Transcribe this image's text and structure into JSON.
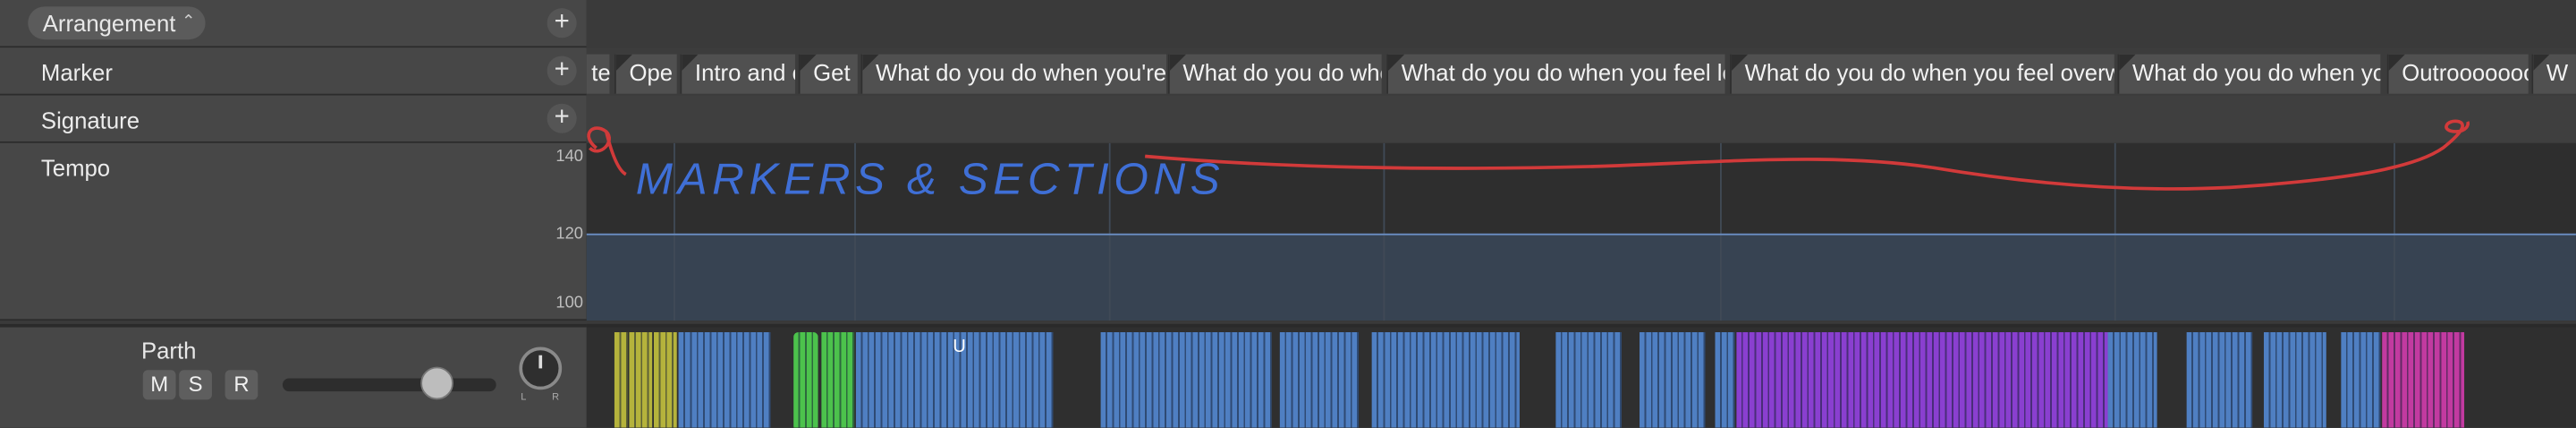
{
  "global_tracks": {
    "arrangement": {
      "label": "Arrangement",
      "chevron": "⌃⌄",
      "add": "+"
    },
    "marker": {
      "label": "Marker",
      "add": "+"
    },
    "signature": {
      "label": "Signature",
      "add": "+"
    },
    "tempo": {
      "label": "Tempo",
      "ticks": [
        "140",
        "120",
        "100"
      ],
      "tempo_value_bpm": 120
    }
  },
  "markers": [
    {
      "label": "ter"
    },
    {
      "label": "Ope"
    },
    {
      "label": "Intro and catching"
    },
    {
      "label": "Get into"
    },
    {
      "label": "What do you do when you're procrastinating?"
    },
    {
      "label": "What do you do when you want to"
    },
    {
      "label": "What do you do when you feel lonely?"
    },
    {
      "label": "What do you do when you feel overwhelmed?"
    },
    {
      "label": "What do you do when you don't feel inspired to do"
    },
    {
      "label": "Outroooooooo"
    },
    {
      "label": "W"
    }
  ],
  "annotation": {
    "text": "MARKERS & SECTIONS",
    "color": "#3f6fd6",
    "line_color": "#d23a3a"
  },
  "track": {
    "name": "Parth",
    "buttons": {
      "mute": "M",
      "solo": "S",
      "record": "R"
    },
    "pan_labels": [
      "L",
      "R"
    ],
    "region_letter": "U",
    "volume_level": 0.72
  },
  "colors": {
    "yellow": "#b5b33c",
    "green": "#4cc24c",
    "blue": "#4f7fc2",
    "purple": "#8a3fd0",
    "pink": "#c23aa0"
  }
}
